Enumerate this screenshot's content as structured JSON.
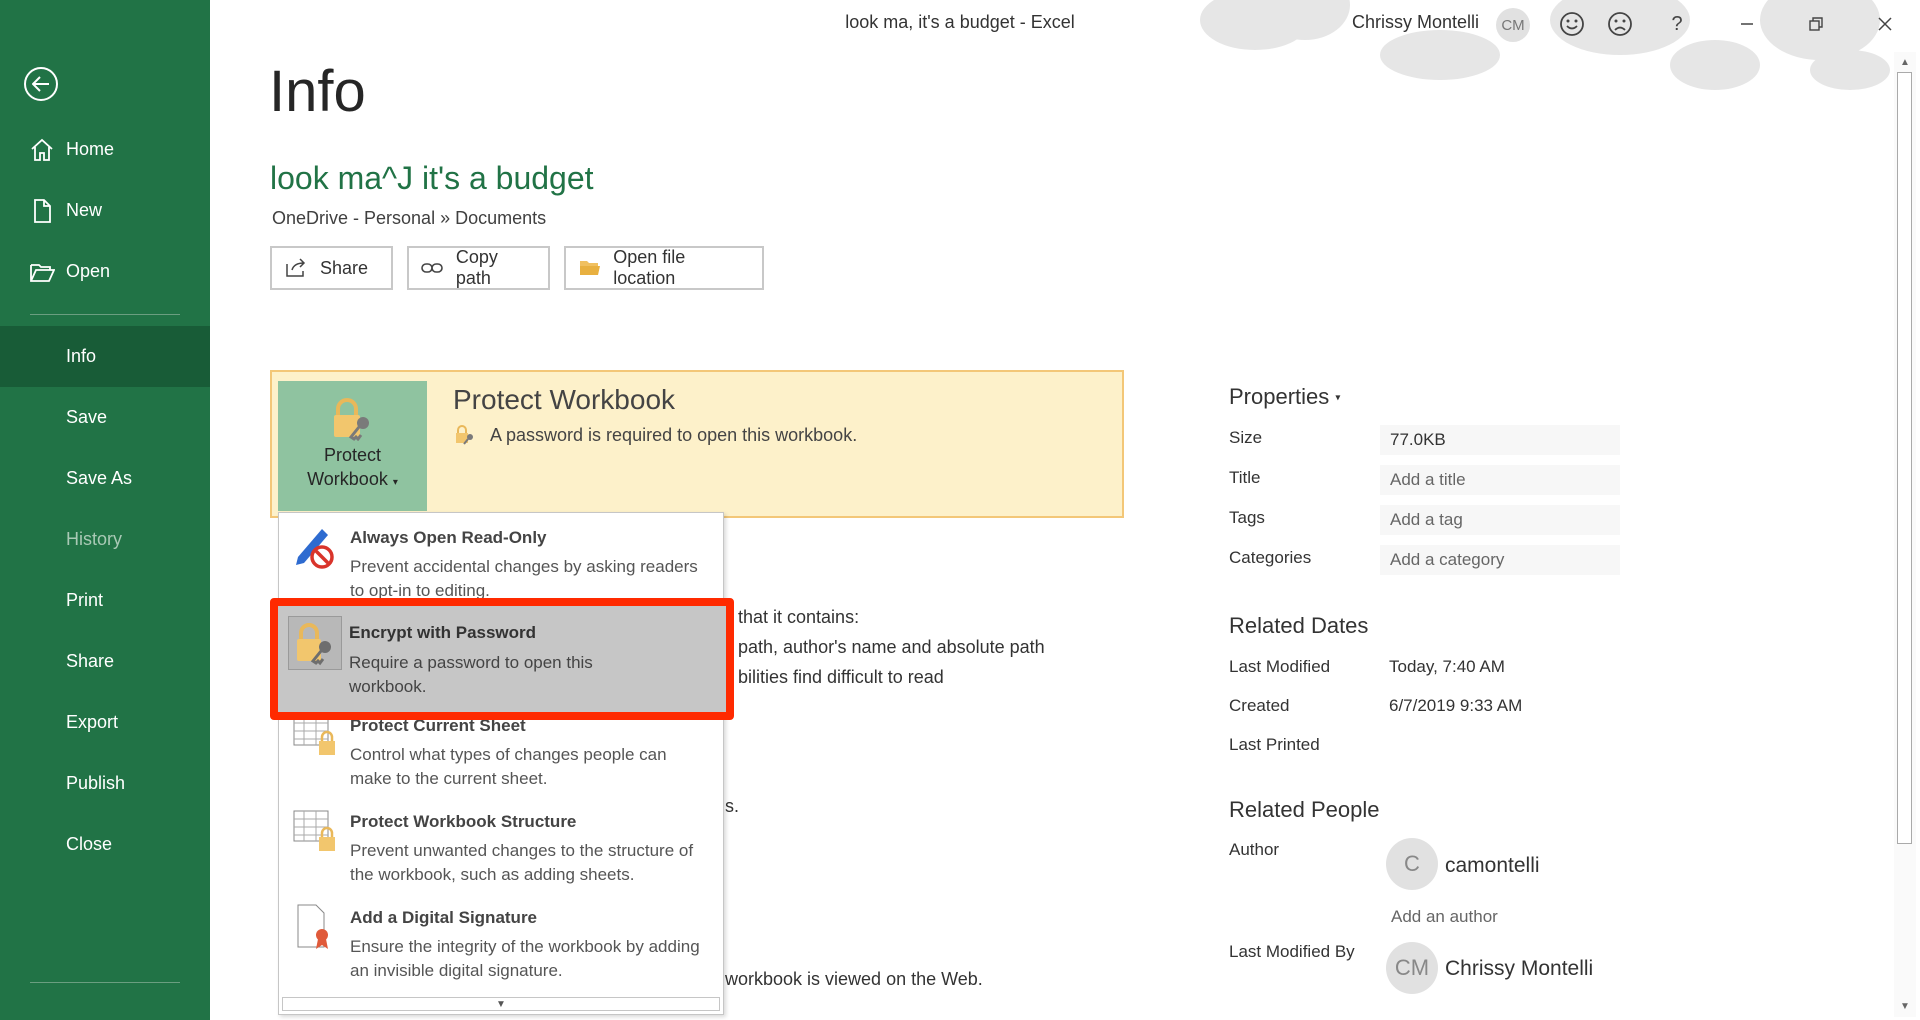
{
  "window": {
    "title": "look ma, it's a budget  -  Excel",
    "user_name": "Chrissy Montelli",
    "user_initials": "CM"
  },
  "sidebar": {
    "items": [
      {
        "label": "Home",
        "icon": "home-icon"
      },
      {
        "label": "New",
        "icon": "new-doc-icon"
      },
      {
        "label": "Open",
        "icon": "folder-open-icon"
      },
      {
        "label": "Info"
      },
      {
        "label": "Save"
      },
      {
        "label": "Save As"
      },
      {
        "label": "History"
      },
      {
        "label": "Print"
      },
      {
        "label": "Share"
      },
      {
        "label": "Export"
      },
      {
        "label": "Publish"
      },
      {
        "label": "Close"
      }
    ],
    "active": "Info",
    "disabled": "History",
    "colors": {
      "bg": "#217346",
      "active_bg": "#185c37"
    }
  },
  "main": {
    "page_title": "Info",
    "doc_title": "look ma^J it's a budget",
    "doc_path": "OneDrive - Personal » Documents",
    "actions": {
      "share": "Share",
      "copy_path": "Copy path",
      "open_location": "Open file location"
    },
    "protect": {
      "button_line1": "Protect",
      "button_line2": "Workbook",
      "heading": "Protect Workbook",
      "desc": "A password is required to open this workbook."
    },
    "background_text": {
      "line1": "that it contains:",
      "line2": "path, author's name and absolute path",
      "line3": "bilities find difficult to read",
      "line4": "s.",
      "line5": "workbook is viewed on the Web."
    },
    "menu": [
      {
        "title": "Always Open Read-Only",
        "desc": "Prevent accidental changes by asking readers to opt-in to editing."
      },
      {
        "title": "Encrypt with Password",
        "desc": "Require a password to open this workbook."
      },
      {
        "title": "Protect Current Sheet",
        "desc": "Control what types of changes people can make to the current sheet."
      },
      {
        "title": "Protect Workbook Structure",
        "desc": "Prevent unwanted changes to the structure of the workbook, such as adding sheets."
      },
      {
        "title": "Add a Digital Signature",
        "desc": "Ensure the integrity of the workbook by adding an invisible digital signature."
      }
    ]
  },
  "properties": {
    "heading": "Properties",
    "size_label": "Size",
    "size_value": "77.0KB",
    "title_label": "Title",
    "title_placeholder": "Add a title",
    "tags_label": "Tags",
    "tags_placeholder": "Add a tag",
    "categories_label": "Categories",
    "categories_placeholder": "Add a category",
    "related_dates_heading": "Related Dates",
    "last_modified_label": "Last Modified",
    "last_modified_value": "Today, 7:40 AM",
    "created_label": "Created",
    "created_value": "6/7/2019 9:33 AM",
    "last_printed_label": "Last Printed",
    "related_people_heading": "Related People",
    "author_label": "Author",
    "author_initial": "C",
    "author_name": "camontelli",
    "add_author": "Add an author",
    "last_modified_by_label": "Last Modified By",
    "last_modified_by_initials": "CM",
    "last_modified_by_name": "Chrissy Montelli"
  }
}
